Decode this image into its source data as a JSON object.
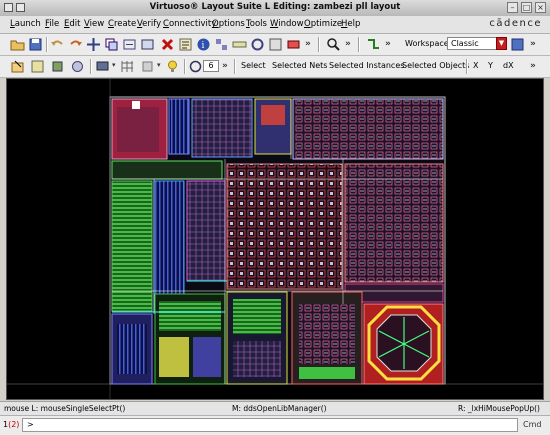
{
  "window": {
    "title": "Virtuoso® Layout Suite L Editing: zambezi pll layout"
  },
  "menu": [
    "Launch",
    "File",
    "Edit",
    "View",
    "Create",
    "Verify",
    "Connectivity",
    "Options",
    "Tools",
    "Window",
    "Optimize",
    "Help"
  ],
  "logo": "cādence",
  "toolbar1": {
    "workspace_label": "Workspace:",
    "workspace_value": "Classic"
  },
  "toolbar2": {
    "spin_value": "6",
    "select_label": "Select",
    "selected_nets": "Selected Nets",
    "selected_instances": "Selected Instances",
    "selected_objects": "Selected Objects",
    "x_label": "X",
    "y_label": "Y",
    "dx_label": "dX"
  },
  "status": {
    "left": "mouse L: mouseSingleSelectPt()",
    "middle": "M: ddsOpenLibManager()",
    "right": "R: _lxHiMousePopUp()"
  },
  "command": {
    "number": "1",
    "count": "(2)",
    "prompt": ">",
    "label": "Cmd"
  }
}
